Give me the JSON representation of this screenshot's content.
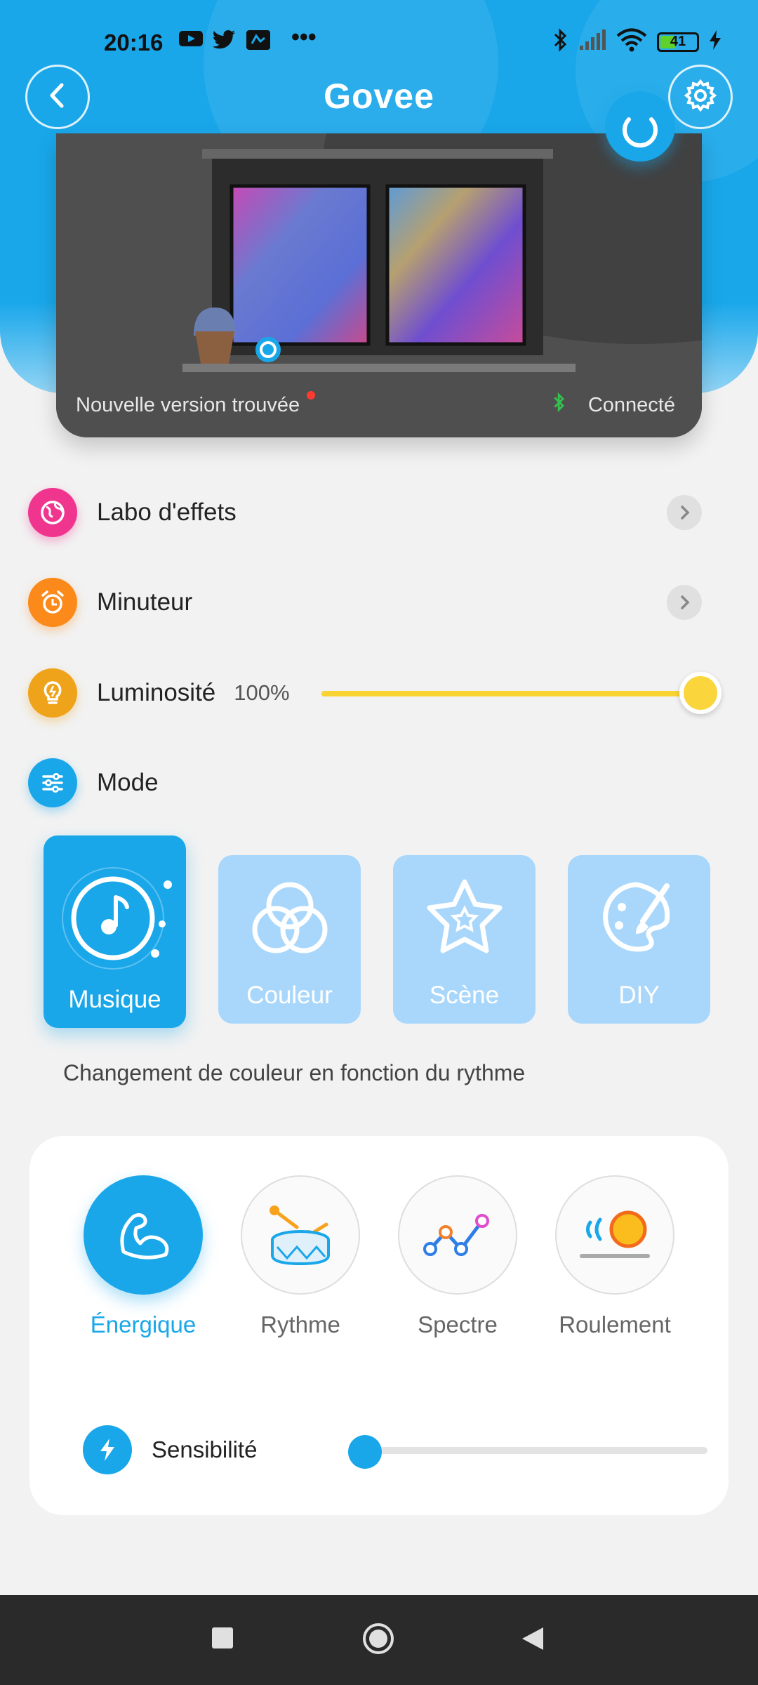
{
  "status_bar": {
    "time": "20:16",
    "battery": "41"
  },
  "header": {
    "logo": "Govee"
  },
  "device": {
    "update_text": "Nouvelle version trouvée",
    "connection": "Connecté"
  },
  "rows": {
    "effects_lab": "Labo d'effets",
    "timer": "Minuteur",
    "brightness": "Luminosité",
    "brightness_value": "100%",
    "mode": "Mode"
  },
  "brightness_level": 1.0,
  "modes": [
    {
      "label": "Musique",
      "icon": "music-note-icon",
      "active": true
    },
    {
      "label": "Couleur",
      "icon": "color-circles-icon",
      "active": false
    },
    {
      "label": "Scène",
      "icon": "star-icon",
      "active": false
    },
    {
      "label": "DIY",
      "icon": "palette-brush-icon",
      "active": false
    }
  ],
  "mode_description": "Changement de couleur en fonction du rythme",
  "music_effects": [
    {
      "label": "Énergique",
      "icon": "flexed-arm-icon",
      "active": true
    },
    {
      "label": "Rythme",
      "icon": "drum-icon",
      "active": false
    },
    {
      "label": "Spectre",
      "icon": "spectrum-line-icon",
      "active": false
    },
    {
      "label": "Roulement",
      "icon": "rolling-icon",
      "active": false
    }
  ],
  "sensitivity": {
    "label": "Sensibilité",
    "level": 0.0
  },
  "colors": {
    "accent": "#19a7ea",
    "brightness": "#fad53c",
    "effects_icon": "#f0358f",
    "timer_icon": "#fb8a1b"
  }
}
